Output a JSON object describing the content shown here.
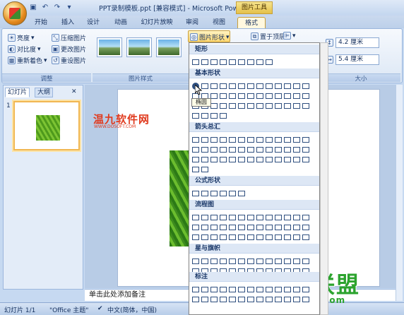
{
  "title_bar": {
    "document_title": "PPT录制模板.ppt [兼容模式] - Microsoft PowerP...",
    "context_tab_title": "图片工具"
  },
  "tabs": [
    "开始",
    "插入",
    "设计",
    "动画",
    "幻灯片放映",
    "审阅",
    "视图",
    "格式"
  ],
  "ribbon": {
    "adjust_group": {
      "label": "调整",
      "brightness": "亮度",
      "contrast": "对比度",
      "recolor": "重新着色",
      "compress": "压缩图片",
      "change_picture": "更改图片",
      "reset_picture": "重设图片"
    },
    "styles_group": {
      "label": "图片样式"
    },
    "shapes_button": "图片形状",
    "arrange": {
      "bring_front": "置于顶层"
    },
    "size_group": {
      "label": "大小",
      "height": "4.2 厘米",
      "width": "5.4 厘米"
    }
  },
  "left_pane": {
    "tab_slides": "幻灯片",
    "tab_outline": "大纲",
    "slide_number": "1"
  },
  "watermark_top": {
    "text": "温九软件网",
    "url": "WWW.DOSOFT.COM"
  },
  "notes_placeholder": "单击此处添加备注",
  "status_bar": {
    "slide_info": "幻灯片 1/1",
    "theme": "\"Office 主题\"",
    "language": "中文(简体，中国)"
  },
  "watermark_bottom": {
    "text": "技术员联盟",
    "url": "www.jsgho.com"
  },
  "shapes_menu": {
    "sections": [
      "矩形",
      "基本形状",
      "箭头总汇",
      "公式形状",
      "流程图",
      "星与旗帜",
      "标注"
    ],
    "tooltip": "椭圆"
  }
}
